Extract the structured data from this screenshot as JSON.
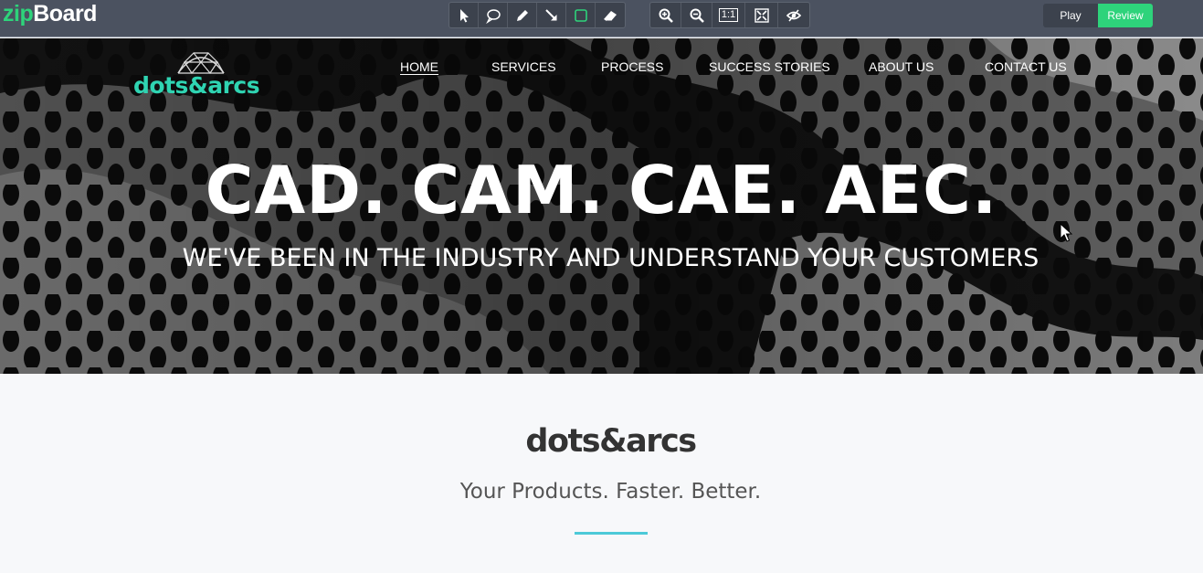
{
  "app": {
    "logo_part1": "zip",
    "logo_part2": "Board",
    "accent": "#2ed37b",
    "toolbar_bg": "#4b5260",
    "annotation_tools": [
      {
        "name": "pointer-icon"
      },
      {
        "name": "comment-bubble-icon"
      },
      {
        "name": "pencil-icon"
      },
      {
        "name": "arrow-icon"
      },
      {
        "name": "rectangle-icon"
      },
      {
        "name": "eraser-icon"
      }
    ],
    "view_tools": [
      {
        "name": "zoom-in-icon"
      },
      {
        "name": "zoom-out-icon"
      },
      {
        "name": "actual-size-icon",
        "label": "1:1"
      },
      {
        "name": "fit-screen-icon"
      },
      {
        "name": "hide-annotations-icon"
      }
    ],
    "mode": {
      "play_label": "Play",
      "review_label": "Review",
      "active": "Review"
    }
  },
  "site": {
    "logo_text": "dots&arcs",
    "brand_color": "#2fd4b2",
    "nav": [
      {
        "label": "HOME",
        "active": true
      },
      {
        "label": "SERVICES",
        "active": false
      },
      {
        "label": "PROCESS",
        "active": false
      },
      {
        "label": "SUCCESS STORIES",
        "active": false
      },
      {
        "label": "ABOUT US",
        "active": false
      },
      {
        "label": "CONTACT US",
        "active": false
      }
    ],
    "hero": {
      "title": "CAD. CAM. CAE. AEC.",
      "subtitle": "WE'VE BEEN IN THE INDUSTRY AND UNDERSTAND YOUR CUSTOMERS"
    },
    "intro": {
      "title": "dots&arcs",
      "tagline": "Your Products. Faster. Better.",
      "divider_color": "#4cc9d8"
    }
  }
}
